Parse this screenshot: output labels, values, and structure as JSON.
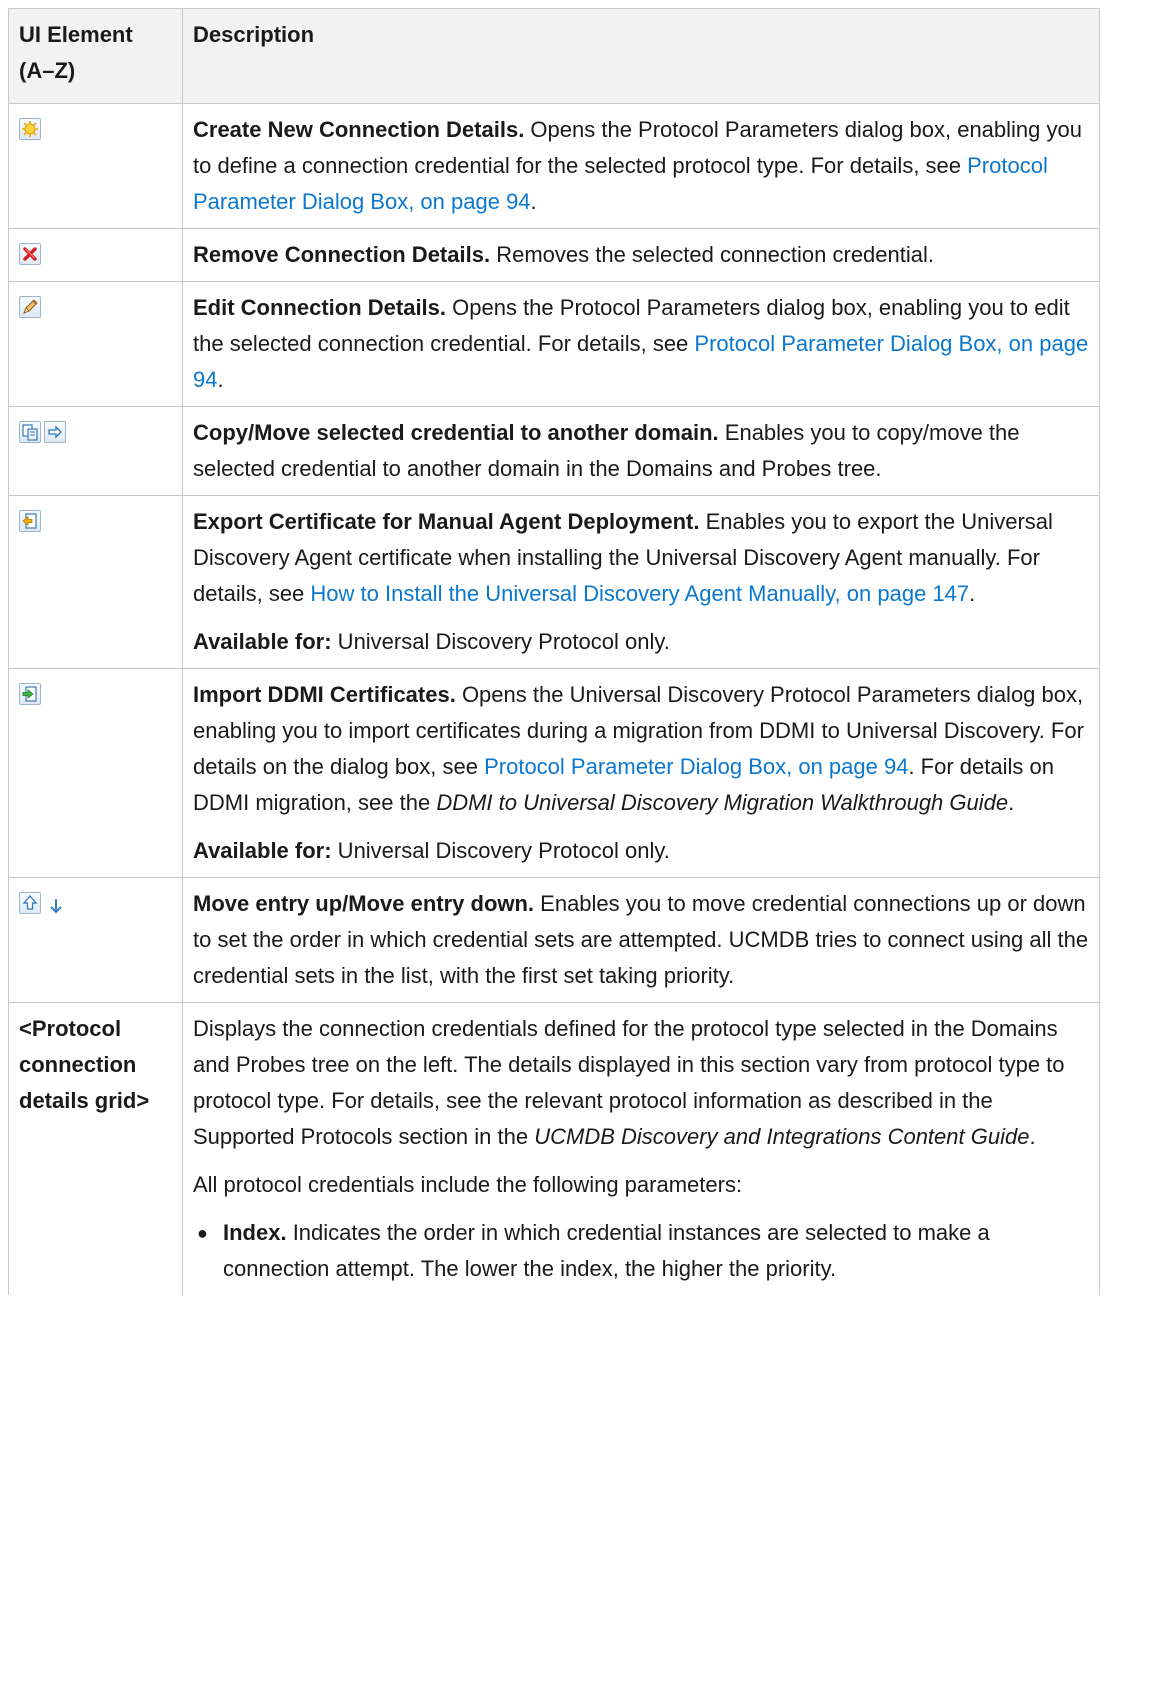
{
  "header": {
    "col1_line1": "UI Element",
    "col1_line2": "(A–Z)",
    "col2": "Description"
  },
  "rows": [
    {
      "icons": [
        "new-sparkle-icon"
      ],
      "title": "Create New Connection Details.",
      "text": " Opens the Protocol Parameters dialog box, enabling you to define a connection credential for the selected protocol type. For details, see ",
      "link": "Protocol Parameter Dialog Box, on page 94",
      "after": "."
    },
    {
      "icons": [
        "remove-x-icon"
      ],
      "title": "Remove Connection Details.",
      "text": " Removes the selected connection credential."
    },
    {
      "icons": [
        "edit-pencil-icon"
      ],
      "title": "Edit Connection Details.",
      "text": " Opens the Protocol Parameters dialog box, enabling you to edit the selected connection credential. For details, see ",
      "link": "Protocol Parameter Dialog Box, on page 94",
      "after": "."
    },
    {
      "icons": [
        "copy-icon",
        "move-arrow-icon"
      ],
      "title": "Copy/Move selected credential to another domain.",
      "text": " Enables you to copy/move the selected credential to another domain in the Domains and Probes tree."
    },
    {
      "icons": [
        "export-certificate-icon"
      ],
      "title": "Export Certificate for Manual Agent Deployment.",
      "text": " Enables you to export the Universal Discovery Agent certificate when installing the Universal Discovery Agent manually. For details, see ",
      "link": "How to Install the Universal Discovery Agent Manually, on page 147",
      "after": ".",
      "avail_label": "Available for:",
      "avail_text": " Universal Discovery Protocol only."
    },
    {
      "icons": [
        "import-certificate-icon"
      ],
      "title": "Import DDMI Certificates.",
      "text": " Opens the Universal Discovery Protocol Parameters dialog box, enabling you to import certificates during a migration from DDMI to Universal Discovery. For details on the dialog box, see ",
      "link": "Protocol Parameter Dialog Box, on page 94",
      "text2": ". For details on DDMI migration, see the ",
      "italic": "DDMI to Universal Discovery Migration Walkthrough Guide",
      "after": ".",
      "avail_label": "Available for:",
      "avail_text": " Universal Discovery Protocol only."
    },
    {
      "icons": [
        "move-up-icon",
        "move-down-icon"
      ],
      "title": "Move entry up/Move entry down.",
      "text": " Enables you to move credential connections up or down to set the order in which credential sets are attempted. UCMDB tries to connect using all the credential sets in the list, with the first set taking priority."
    },
    {
      "element_label": "<Protocol connection details grid>",
      "text": "Displays the connection credentials defined for the protocol type selected in the Domains and Probes tree on the left. The details displayed in this section vary from protocol type to protocol type. For details, see the relevant protocol information as described in the Supported Protocols section in the ",
      "italic": "UCMDB Discovery and Integrations Content Guide",
      "after": ".",
      "para2": "All protocol credentials include the following parameters:",
      "bullet_title": "Index.",
      "bullet_text": " Indicates the order in which credential instances are selected to make a connection attempt. The lower the index, the higher the priority."
    }
  ]
}
